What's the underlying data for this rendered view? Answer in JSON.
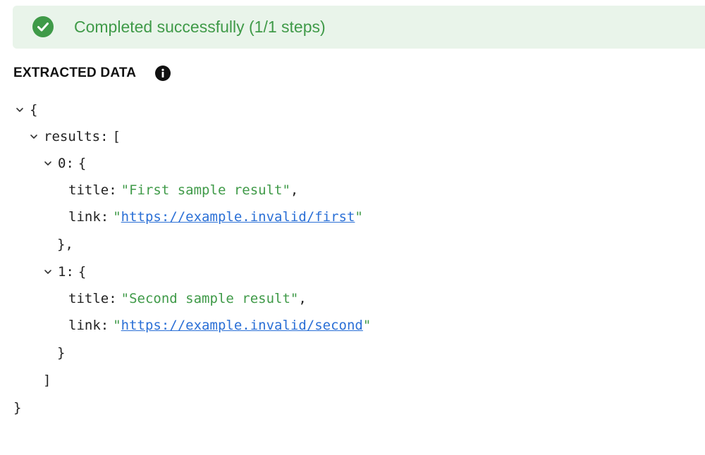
{
  "banner": {
    "message": "Completed successfully (1/1 steps)",
    "icon": "check-circle-icon",
    "color": "#3f9a48",
    "background": "#e9f4ea"
  },
  "section": {
    "title": "EXTRACTED DATA",
    "icon": "info-icon"
  },
  "json_tree": {
    "root_open": "{",
    "root_close": "}",
    "results_key": "results",
    "results_open": "[",
    "results_close": "]",
    "items": [
      {
        "index": "0",
        "open": "{",
        "title_key": "title",
        "title_value": "First sample result",
        "link_key": "link",
        "link_value": "https://example.invalid/first",
        "close": "},"
      },
      {
        "index": "1",
        "open": "{",
        "title_key": "title",
        "title_value": "Second sample result",
        "link_key": "link",
        "link_value": "https://example.invalid/second",
        "close": "}"
      }
    ],
    "string_color": "#3f9a48",
    "link_color": "#2a6fd6"
  }
}
